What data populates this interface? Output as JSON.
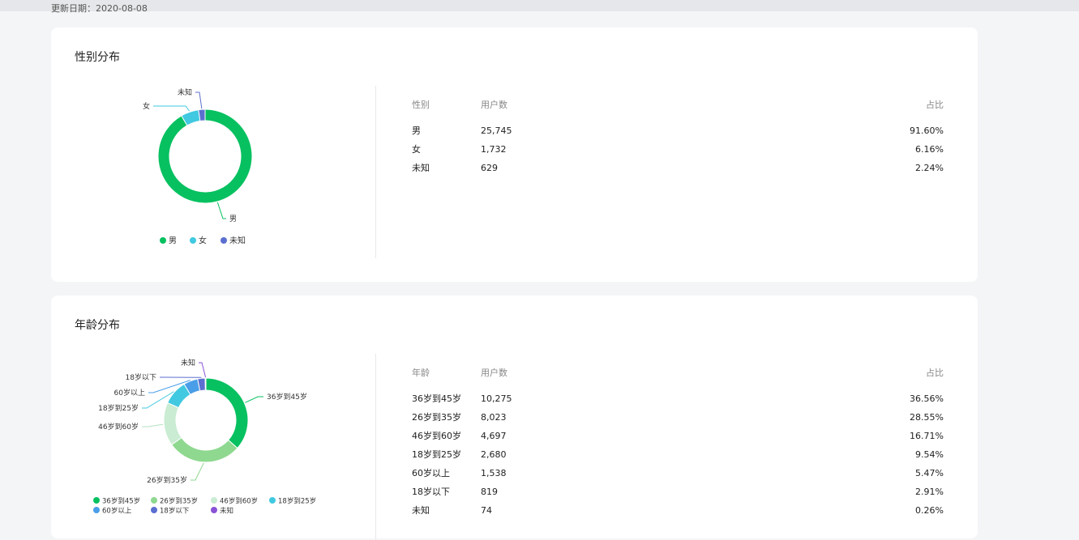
{
  "update_date": "更新日期：2020-08-08",
  "gender": {
    "title": "性别分布",
    "headers": {
      "c1": "性别",
      "c2": "用户数",
      "c3": "占比"
    },
    "rows": [
      {
        "label": "男",
        "count": "25,745",
        "pct": "91.60%"
      },
      {
        "label": "女",
        "count": "1,732",
        "pct": "6.16%"
      },
      {
        "label": "未知",
        "count": "629",
        "pct": "2.24%"
      }
    ]
  },
  "age": {
    "title": "年龄分布",
    "headers": {
      "c1": "年龄",
      "c2": "用户数",
      "c3": "占比"
    },
    "rows": [
      {
        "label": "36岁到45岁",
        "count": "10,275",
        "pct": "36.56%"
      },
      {
        "label": "26岁到35岁",
        "count": "8,023",
        "pct": "28.55%"
      },
      {
        "label": "46岁到60岁",
        "count": "4,697",
        "pct": "16.71%"
      },
      {
        "label": "18岁到25岁",
        "count": "2,680",
        "pct": "9.54%"
      },
      {
        "label": "60岁以上",
        "count": "1,538",
        "pct": "5.47%"
      },
      {
        "label": "18岁以下",
        "count": "819",
        "pct": "2.91%"
      },
      {
        "label": "未知",
        "count": "74",
        "pct": "0.26%"
      }
    ]
  },
  "chart_data": [
    {
      "type": "pie",
      "title": "性别分布",
      "categories": [
        "男",
        "女",
        "未知"
      ],
      "values": [
        25745,
        1732,
        629
      ],
      "colors": [
        "#07c160",
        "#40c9e0",
        "#5b6fd0"
      ],
      "legend": "bottom-center"
    },
    {
      "type": "pie",
      "title": "年龄分布",
      "categories": [
        "36岁到45岁",
        "26岁到35岁",
        "46岁到60岁",
        "18岁到25岁",
        "60岁以上",
        "18岁以下",
        "未知"
      ],
      "values": [
        10275,
        8023,
        4697,
        2680,
        1538,
        819,
        74
      ],
      "colors": [
        "#07c160",
        "#8ed88f",
        "#c9ecd2",
        "#40c9e0",
        "#4a9ee8",
        "#5b6fd0",
        "#8a52d6"
      ],
      "legend": "bottom-center"
    }
  ]
}
